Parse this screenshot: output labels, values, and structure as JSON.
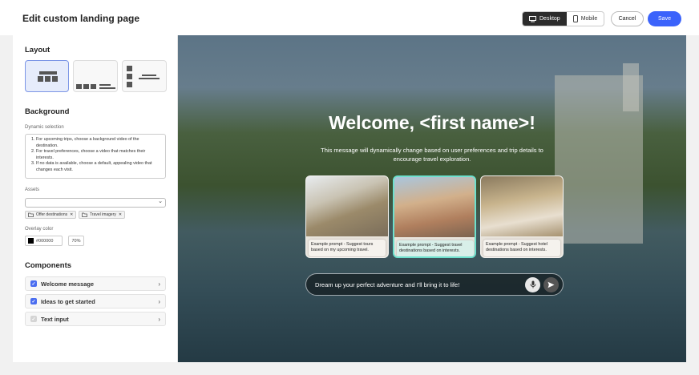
{
  "header": {
    "title": "Edit custom landing page",
    "desktop_label": "Desktop",
    "mobile_label": "Mobile",
    "cancel_label": "Cancel",
    "save_label": "Save"
  },
  "sidebar": {
    "layout_heading": "Layout",
    "background_heading": "Background",
    "dynamic_label": "Dynamic selection",
    "dynamic_items": [
      "For upcoming trips, choose a background video of the destination.",
      "For travel preferences, choose a video that matches their interests.",
      "If no data is available, choose a default, appealing video that changes each visit."
    ],
    "assets_label": "Assets",
    "tags": [
      "Offer destinations",
      "Travel imagery"
    ],
    "overlay_label": "Overlay color",
    "overlay_color": "#000000",
    "overlay_opacity": "70%",
    "components_heading": "Components",
    "components": [
      {
        "label": "Welcome message",
        "checked": true
      },
      {
        "label": "Ideas to get started",
        "checked": true
      },
      {
        "label": "Text input",
        "checked": false
      }
    ]
  },
  "preview": {
    "title": "Welcome, <first name>!",
    "subtitle": "This message will dynamically change based on user preferences and trip details to encourage travel exploration.",
    "cards": [
      {
        "prompt": "Example prompt - Suggest tours based on my upcoming travel."
      },
      {
        "prompt": "Example prompt - Suggest travel destinations based on interests."
      },
      {
        "prompt": "Example prompt - Suggest hotel destinations based on interests."
      }
    ],
    "input_placeholder": "Dream up your perfect adventure and I'll bring it to life!"
  },
  "colors": {
    "accent": "#3b63fb",
    "selected_card_border": "#6ee0cd"
  }
}
